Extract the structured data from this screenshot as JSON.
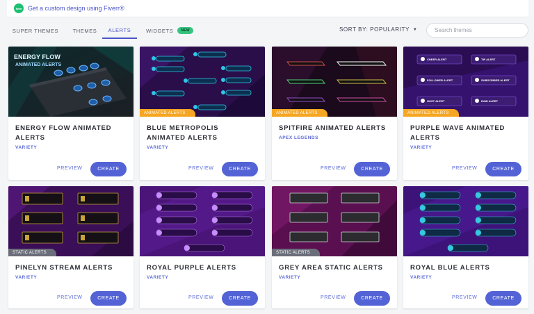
{
  "banner": {
    "badge": "fiverr",
    "text": "Get a custom design using Fiverr®"
  },
  "nav": {
    "tabs": [
      {
        "label": "SUPER THEMES",
        "active": false
      },
      {
        "label": "THEMES",
        "active": false
      },
      {
        "label": "ALERTS",
        "active": true
      },
      {
        "label": "WIDGETS",
        "active": false,
        "badge": "NEW"
      }
    ],
    "sort_label": "SORT BY: POPULARITY",
    "search_placeholder": "Search themes"
  },
  "colors": {
    "accent": "#5363d6",
    "new_badge": "#35c47e",
    "animated_ribbon": "#f5a623",
    "static_ribbon": "#6b6e7a"
  },
  "cards": [
    {
      "title": "ENERGY FLOW ANIMATED ALERTS",
      "category": "VARIETY",
      "ribbon": "",
      "thumb_text": [
        "ENERGY FLOW",
        "ANIMATED ALERTS"
      ],
      "preview": "PREVIEW",
      "create": "CREATE"
    },
    {
      "title": "BLUE METROPOLIS ANIMATED ALERTS",
      "category": "VARIETY",
      "ribbon": "ANIMATED ALERTS",
      "preview": "PREVIEW",
      "create": "CREATE"
    },
    {
      "title": "SPITFIRE ANIMATED ALERTS",
      "category": "APEX LEGENDS",
      "ribbon": "ANIMATED ALERTS",
      "preview": "PREVIEW",
      "create": "CREATE"
    },
    {
      "title": "PURPLE WAVE ANIMATED ALERTS",
      "category": "VARIETY",
      "ribbon": "ANIMATED ALERTS",
      "thumb_text": [
        "CHEER ALERT",
        "TIP ALERT",
        "FOLLOWER ALERT",
        "SUBSCRIBER ALERT",
        "HOST ALERT",
        "RAID ALERT"
      ],
      "preview": "PREVIEW",
      "create": "CREATE"
    },
    {
      "title": "PINELYN STREAM ALERTS",
      "category": "VARIETY",
      "ribbon": "STATIC ALERTS",
      "preview": "PREVIEW",
      "create": "CREATE"
    },
    {
      "title": "ROYAL PURPLE ALERTS",
      "category": "VARIETY",
      "ribbon": "",
      "preview": "PREVIEW",
      "create": "CREATE"
    },
    {
      "title": "GREY AREA STATIC ALERTS",
      "category": "VARIETY",
      "ribbon": "STATIC ALERTS",
      "preview": "PREVIEW",
      "create": "CREATE"
    },
    {
      "title": "ROYAL BLUE ALERTS",
      "category": "VARIETY",
      "ribbon": "",
      "preview": "PREVIEW",
      "create": "CREATE"
    }
  ]
}
